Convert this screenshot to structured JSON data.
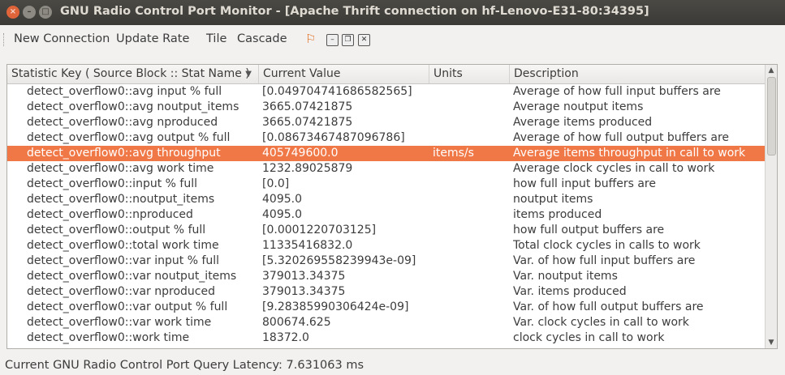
{
  "window": {
    "title": "GNU Radio Control Port Monitor - [Apache Thrift connection on hf-Lenovo-E31-80:34395]"
  },
  "menubar": {
    "items": [
      "New Connection",
      "Update Rate",
      "Tile",
      "Cascade"
    ],
    "tool_icon": "flowgraph-icon"
  },
  "table": {
    "columns": [
      "Statistic Key ( Source Block :: Stat Name )",
      "Current Value",
      "Units",
      "Description"
    ],
    "rows": [
      {
        "key": "detect_overflow0::avg input % full",
        "value": "[0.049704741686582565]",
        "units": "",
        "desc": "Average of how full input buffers are"
      },
      {
        "key": "detect_overflow0::avg noutput_items",
        "value": "3665.07421875",
        "units": "",
        "desc": "Average noutput items"
      },
      {
        "key": "detect_overflow0::avg nproduced",
        "value": "3665.07421875",
        "units": "",
        "desc": "Average items produced"
      },
      {
        "key": "detect_overflow0::avg output % full",
        "value": "[0.08673467487096786]",
        "units": "",
        "desc": "Average of how full output buffers are"
      },
      {
        "key": "detect_overflow0::avg throughput",
        "value": "405749600.0",
        "units": "items/s",
        "desc": "Average items throughput in call to work"
      },
      {
        "key": "detect_overflow0::avg work time",
        "value": "1232.89025879",
        "units": "",
        "desc": "Average clock cycles in call to work"
      },
      {
        "key": "detect_overflow0::input % full",
        "value": "[0.0]",
        "units": "",
        "desc": "how full input buffers are"
      },
      {
        "key": "detect_overflow0::noutput_items",
        "value": "4095.0",
        "units": "",
        "desc": "noutput items"
      },
      {
        "key": "detect_overflow0::nproduced",
        "value": "4095.0",
        "units": "",
        "desc": "items produced"
      },
      {
        "key": "detect_overflow0::output % full",
        "value": "[0.0001220703125]",
        "units": "",
        "desc": "how full output buffers are"
      },
      {
        "key": "detect_overflow0::total work time",
        "value": "11335416832.0",
        "units": "",
        "desc": "Total clock cycles in calls to work"
      },
      {
        "key": "detect_overflow0::var input % full",
        "value": "[5.320269558239943e-09]",
        "units": "",
        "desc": "Var. of how full input buffers are"
      },
      {
        "key": "detect_overflow0::var noutput_items",
        "value": "379013.34375",
        "units": "",
        "desc": "Var. noutput items"
      },
      {
        "key": "detect_overflow0::var nproduced",
        "value": "379013.34375",
        "units": "",
        "desc": "Var. items produced"
      },
      {
        "key": "detect_overflow0::var output % full",
        "value": "[9.28385990306424e-09]",
        "units": "",
        "desc": "Var. of how full output buffers are"
      },
      {
        "key": "detect_overflow0::var work time",
        "value": "800674.625",
        "units": "",
        "desc": "Var. clock cycles in call to work"
      },
      {
        "key": "detect_overflow0::work time",
        "value": "18372.0",
        "units": "",
        "desc": "clock cycles in call to work"
      }
    ],
    "selected_row": 4
  },
  "colors": {
    "selection": "#f07746",
    "titlebar": "#3b3a36"
  },
  "status": {
    "text": "Current GNU Radio Control Port Query Latency: 7.631063 ms"
  }
}
